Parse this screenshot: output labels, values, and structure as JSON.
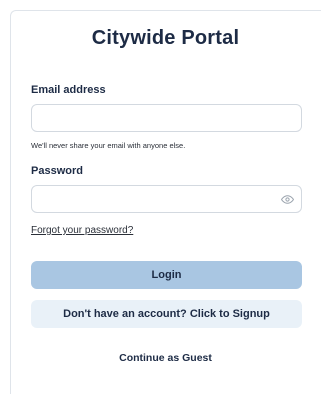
{
  "portal": {
    "title": "Citywide Portal"
  },
  "email": {
    "label": "Email address",
    "value": "",
    "help_text": "We'll never share your email with anyone else."
  },
  "password": {
    "label": "Password",
    "value": "",
    "toggle_icon": "eye-icon"
  },
  "links": {
    "forgot_password": "Forgot your password?",
    "continue_guest": "Continue as Guest"
  },
  "buttons": {
    "login": "Login",
    "signup": "Don't have an account? Click to Signup"
  },
  "colors": {
    "primary_button": "#a9c6e2",
    "secondary_button": "#e9f1f8",
    "text_dark": "#1d2b45"
  }
}
